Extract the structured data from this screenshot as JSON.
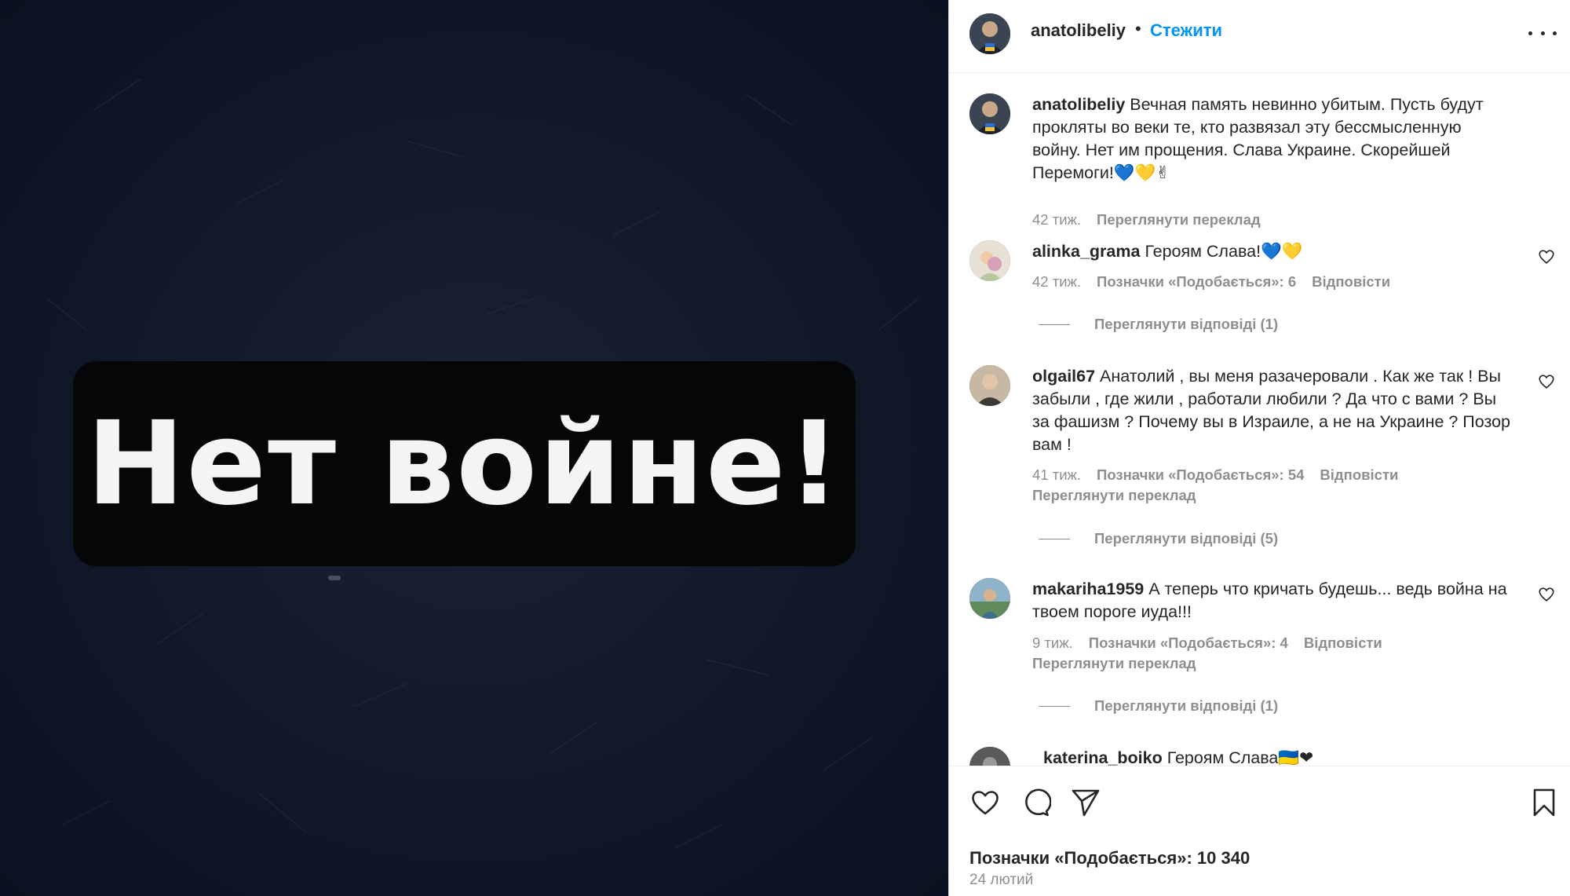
{
  "media": {
    "banner_text": "Нет войне!"
  },
  "header": {
    "username": "anatolibeliy",
    "separator": "•",
    "follow_label": "Стежити"
  },
  "caption": {
    "username": "anatolibeliy",
    "text": "Вечная память невинно убитым. Пусть будут прокляты во веки те, кто развязал эту бессмысленную войну. Нет им прощения. Слава Украине. Скорейшей Перемоги!",
    "emojis": "💙💛✌",
    "time": "42 тиж.",
    "translate_label": "Переглянути переклад"
  },
  "comments": [
    {
      "username": "alinka_grama",
      "text": "Героям Слава!",
      "emojis": "💙💛",
      "time": "42 тиж.",
      "likes_label": "Позначки «Подобається»: 6",
      "reply_label": "Відповісти",
      "view_replies": "Переглянути відповіді (1)"
    },
    {
      "username": "olgail67",
      "text": "Анатолий , вы меня разачеровали . Как же так ! Вы забыли , где жили , работали любили ? Да что с вами ? Вы за фашизм ? Почему вы в Израиле, а не на Украине ? Позор вам !",
      "time": "41 тиж.",
      "likes_label": "Позначки «Подобається»: 54",
      "reply_label": "Відповісти",
      "translate_label": "Переглянути переклад",
      "view_replies": "Переглянути відповіді (5)"
    },
    {
      "username": "makariha1959",
      "text": "А теперь что кричать будешь... ведь война на твоем пороге иуда!!!",
      "time": "9 тиж.",
      "likes_label": "Позначки «Подобається»: 4",
      "reply_label": "Відповісти",
      "translate_label": "Переглянути переклад",
      "view_replies": "Переглянути відповіді (1)"
    },
    {
      "username": "katerina_boiko",
      "text": "Героям Слава",
      "emojis": "🇺🇦❤"
    }
  ],
  "footer": {
    "likes": "Позначки «Подобається»: 10 340",
    "date": "24 лютий"
  },
  "icons": {
    "like": "heart-icon",
    "comment": "comment-icon",
    "share": "paper-plane-icon",
    "save": "bookmark-icon",
    "more": "more-options-icon"
  },
  "colors": {
    "accent": "#0095f6",
    "text": "#262626",
    "muted": "#8e8e8e",
    "heart_blue": "#3b7ddd",
    "heart_yellow": "#f5c542"
  }
}
